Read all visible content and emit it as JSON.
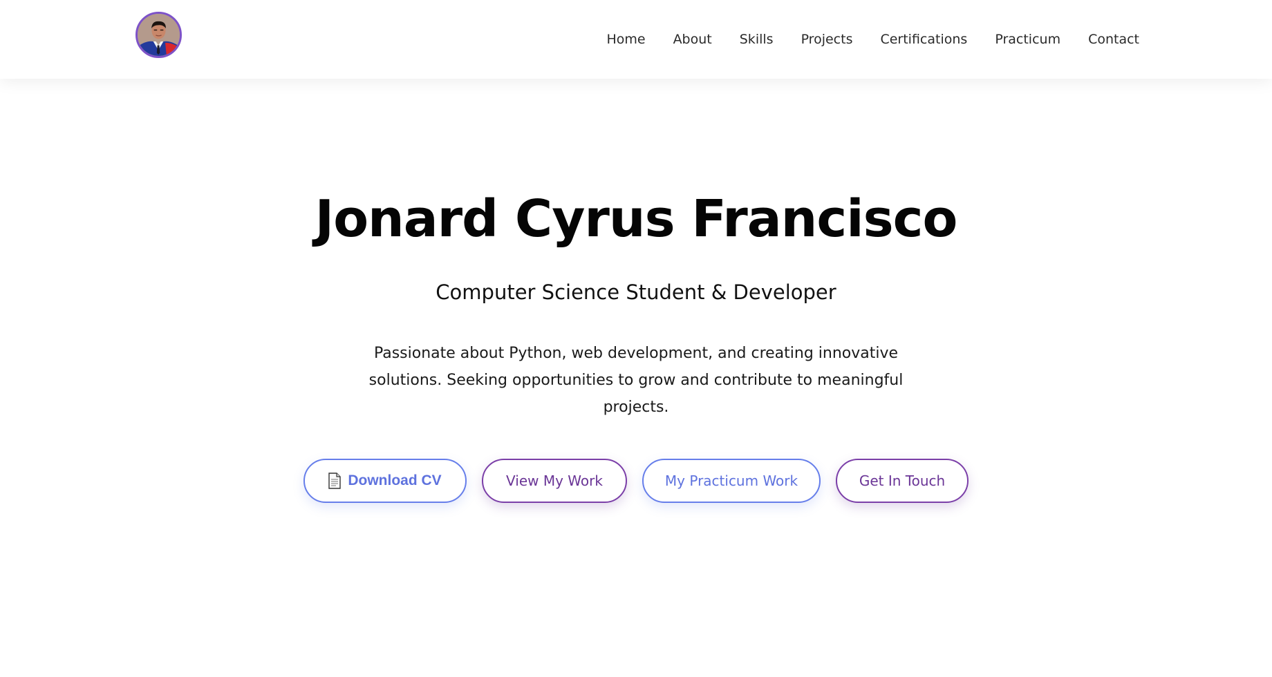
{
  "nav": {
    "items": [
      "Home",
      "About",
      "Skills",
      "Projects",
      "Certifications",
      "Practicum",
      "Contact"
    ]
  },
  "hero": {
    "name": "Jonard Cyrus Francisco",
    "subtitle": "Computer Science Student & Developer",
    "description": "Passionate about Python, web development, and creating innovative solutions. Seeking opportunities to grow and contribute to meaningful projects."
  },
  "buttons": {
    "download_cv": "Download CV",
    "view_work": "View My Work",
    "practicum_work": "My Practicum Work",
    "get_in_touch": "Get In Touch"
  },
  "icons": {
    "cv_icon": "document-icon",
    "profile": "avatar"
  },
  "colors": {
    "accent_blue": "#667eea",
    "accent_purple": "#764ba2"
  }
}
